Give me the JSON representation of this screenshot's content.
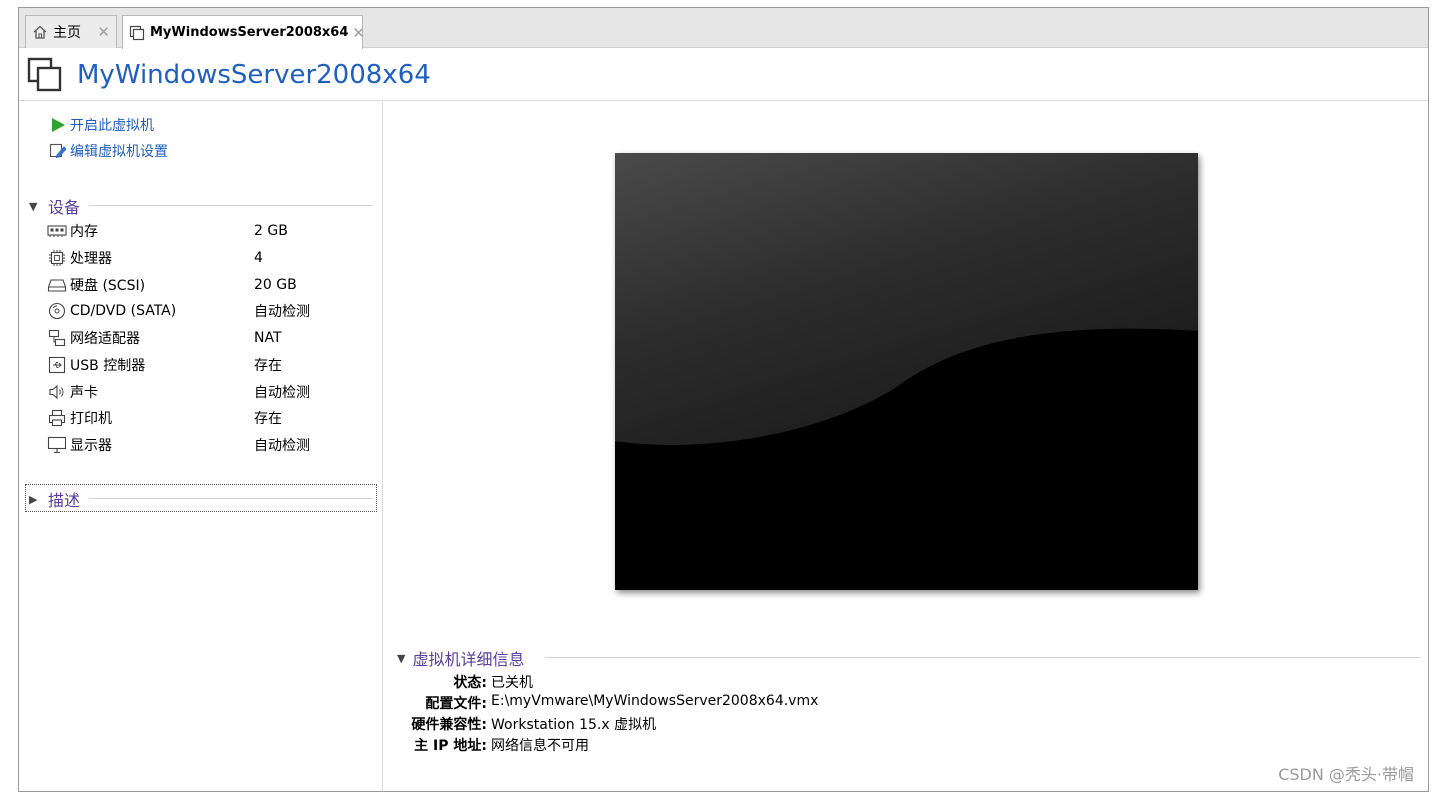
{
  "tabs": [
    {
      "label": "主页",
      "icon": "home-icon"
    },
    {
      "label": "MyWindowsServer2008x64",
      "icon": "vm-icon"
    }
  ],
  "page_title": "MyWindowsServer2008x64",
  "actions": {
    "power_on": "开启此虚拟机",
    "edit_settings": "编辑虚拟机设置"
  },
  "devices": {
    "header": "设备",
    "items": [
      {
        "name": "内存",
        "value": "2 GB",
        "icon": "memory-icon"
      },
      {
        "name": "处理器",
        "value": "4",
        "icon": "cpu-icon"
      },
      {
        "name": "硬盘 (SCSI)",
        "value": "20 GB",
        "icon": "hard-disk-icon"
      },
      {
        "name": "CD/DVD (SATA)",
        "value": "自动检测",
        "icon": "cd-dvd-icon"
      },
      {
        "name": "网络适配器",
        "value": "NAT",
        "icon": "network-icon"
      },
      {
        "name": "USB 控制器",
        "value": "存在",
        "icon": "usb-icon"
      },
      {
        "name": "声卡",
        "value": "自动检测",
        "icon": "speaker-icon"
      },
      {
        "name": "打印机",
        "value": "存在",
        "icon": "printer-icon"
      },
      {
        "name": "显示器",
        "value": "自动检测",
        "icon": "monitor-icon"
      }
    ]
  },
  "description": {
    "header": "描述"
  },
  "details": {
    "header": "虚拟机详细信息",
    "rows": [
      {
        "label": "状态:",
        "value": "已关机"
      },
      {
        "label": "配置文件:",
        "value": "E:\\myVmware\\MyWindowsServer2008x64.vmx"
      },
      {
        "label": "硬件兼容性:",
        "value": "Workstation 15.x 虚拟机"
      },
      {
        "label": "主 IP 地址:",
        "value": "网络信息不可用"
      }
    ]
  },
  "watermark": "CSDN @秃头·带帽",
  "colors": {
    "link": "#1f5fbf",
    "section": "#5a3fa0",
    "play": "#2ea32e"
  }
}
